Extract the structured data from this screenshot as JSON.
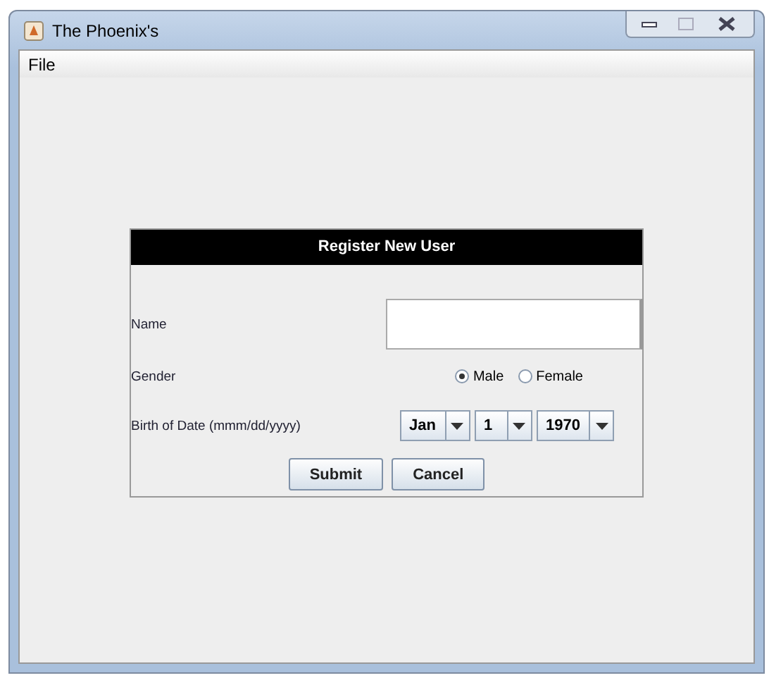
{
  "window": {
    "title": "The Phoenix's"
  },
  "menu": [
    "File"
  ],
  "form": {
    "title": "Register New User",
    "name": {
      "label": "Name"
    },
    "gender": {
      "label": "Gender",
      "options": [
        {
          "label": "Male",
          "selected": true
        },
        {
          "label": "Female",
          "selected": false
        }
      ]
    },
    "birth": {
      "label": "Birth of Date (mmm/dd/yyyy)",
      "fields": [
        "Jan",
        "1",
        "1970"
      ]
    },
    "buttons": [
      "Submit",
      "Cancel"
    ]
  }
}
